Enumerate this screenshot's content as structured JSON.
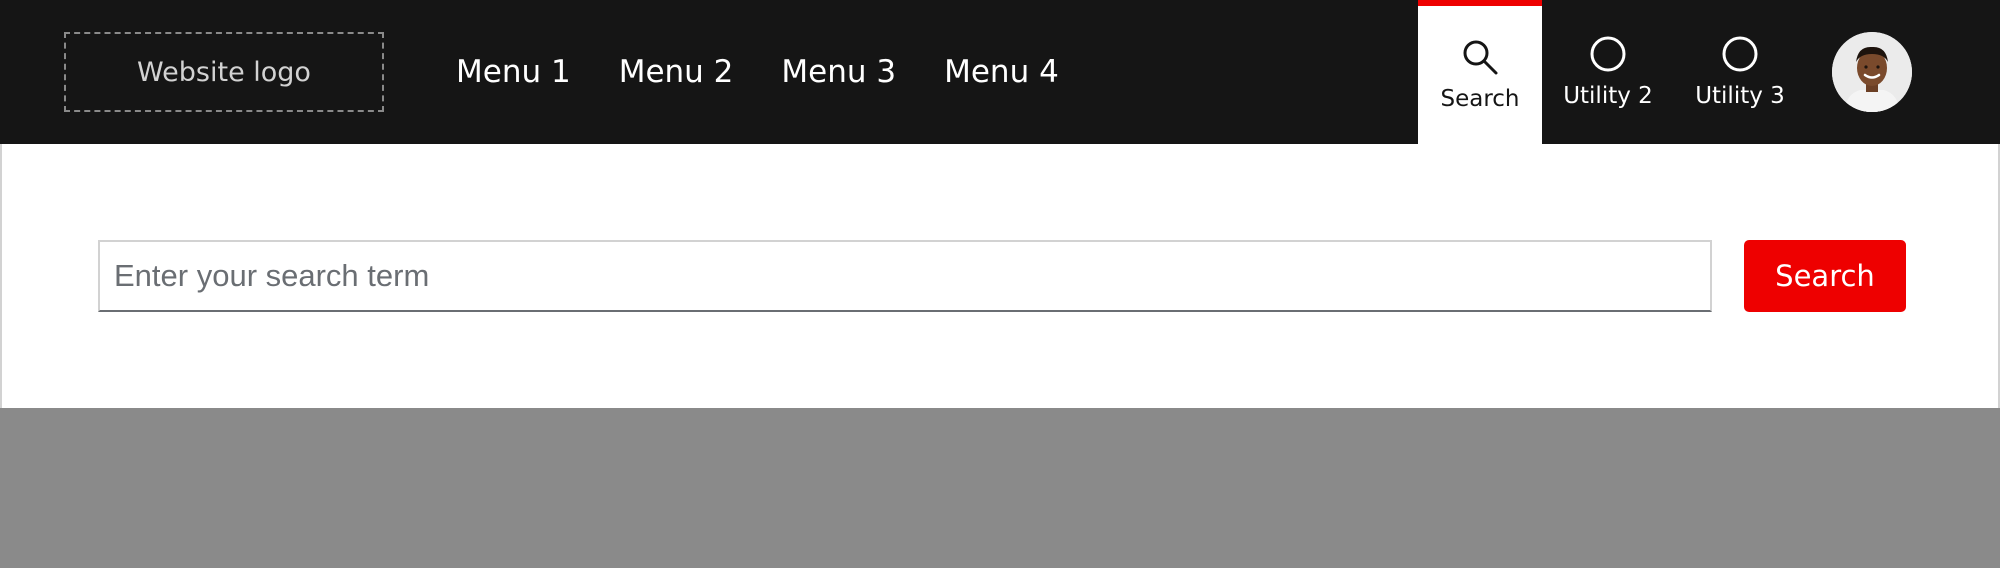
{
  "header": {
    "logo_text": "Website logo",
    "menu": [
      {
        "label": "Menu 1"
      },
      {
        "label": "Menu 2"
      },
      {
        "label": "Menu 3"
      },
      {
        "label": "Menu 4"
      }
    ],
    "utilities": [
      {
        "label": "Search",
        "icon": "search-icon",
        "active": true
      },
      {
        "label": "Utility 2",
        "icon": "circle-icon",
        "active": false
      },
      {
        "label": "Utility 3",
        "icon": "circle-icon",
        "active": false
      }
    ],
    "avatar_icon": "user-avatar"
  },
  "search": {
    "placeholder": "Enter your search term",
    "value": "",
    "button_label": "Search"
  },
  "colors": {
    "navbar_bg": "#151515",
    "accent": "#ee0000",
    "backdrop": "#8a8a8a",
    "panel_bg": "#ffffff"
  }
}
